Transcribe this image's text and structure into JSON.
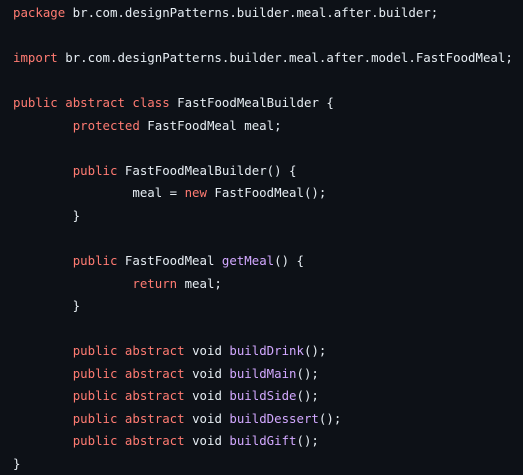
{
  "code": {
    "lines": [
      [
        {
          "t": "package",
          "c": "kw"
        },
        {
          "t": " br.com.designPatterns.builder.meal.after.builder;",
          "c": "tx"
        }
      ],
      [],
      [
        {
          "t": "import",
          "c": "kw"
        },
        {
          "t": " br.com.designPatterns.builder.meal.after.model.FastFoodMeal;",
          "c": "tx"
        }
      ],
      [],
      [
        {
          "t": "public",
          "c": "kw"
        },
        {
          "t": " ",
          "c": "tx"
        },
        {
          "t": "abstract",
          "c": "kw"
        },
        {
          "t": " ",
          "c": "tx"
        },
        {
          "t": "class",
          "c": "kw"
        },
        {
          "t": " FastFoodMealBuilder {",
          "c": "tx"
        }
      ],
      [
        {
          "t": "        ",
          "c": "tx"
        },
        {
          "t": "protected",
          "c": "kw"
        },
        {
          "t": " FastFoodMeal meal;",
          "c": "tx"
        }
      ],
      [],
      [
        {
          "t": "        ",
          "c": "tx"
        },
        {
          "t": "public",
          "c": "kw"
        },
        {
          "t": " FastFoodMealBuilder() {",
          "c": "tx"
        }
      ],
      [
        {
          "t": "                meal = ",
          "c": "tx"
        },
        {
          "t": "new",
          "c": "kw"
        },
        {
          "t": " FastFoodMeal();",
          "c": "tx"
        }
      ],
      [
        {
          "t": "        }",
          "c": "tx"
        }
      ],
      [],
      [
        {
          "t": "        ",
          "c": "tx"
        },
        {
          "t": "public",
          "c": "kw"
        },
        {
          "t": " FastFoodMeal ",
          "c": "tx"
        },
        {
          "t": "getMeal",
          "c": "fn"
        },
        {
          "t": "() {",
          "c": "tx"
        }
      ],
      [
        {
          "t": "                ",
          "c": "tx"
        },
        {
          "t": "return",
          "c": "kw"
        },
        {
          "t": " meal;",
          "c": "tx"
        }
      ],
      [
        {
          "t": "        }",
          "c": "tx"
        }
      ],
      [],
      [
        {
          "t": "        ",
          "c": "tx"
        },
        {
          "t": "public",
          "c": "kw"
        },
        {
          "t": " ",
          "c": "tx"
        },
        {
          "t": "abstract",
          "c": "kw"
        },
        {
          "t": " void ",
          "c": "tx"
        },
        {
          "t": "buildDrink",
          "c": "fn"
        },
        {
          "t": "();",
          "c": "tx"
        }
      ],
      [
        {
          "t": "        ",
          "c": "tx"
        },
        {
          "t": "public",
          "c": "kw"
        },
        {
          "t": " ",
          "c": "tx"
        },
        {
          "t": "abstract",
          "c": "kw"
        },
        {
          "t": " void ",
          "c": "tx"
        },
        {
          "t": "buildMain",
          "c": "fn"
        },
        {
          "t": "();",
          "c": "tx"
        }
      ],
      [
        {
          "t": "        ",
          "c": "tx"
        },
        {
          "t": "public",
          "c": "kw"
        },
        {
          "t": " ",
          "c": "tx"
        },
        {
          "t": "abstract",
          "c": "kw"
        },
        {
          "t": " void ",
          "c": "tx"
        },
        {
          "t": "buildSide",
          "c": "fn"
        },
        {
          "t": "();",
          "c": "tx"
        }
      ],
      [
        {
          "t": "        ",
          "c": "tx"
        },
        {
          "t": "public",
          "c": "kw"
        },
        {
          "t": " ",
          "c": "tx"
        },
        {
          "t": "abstract",
          "c": "kw"
        },
        {
          "t": " void ",
          "c": "tx"
        },
        {
          "t": "buildDessert",
          "c": "fn"
        },
        {
          "t": "();",
          "c": "tx"
        }
      ],
      [
        {
          "t": "        ",
          "c": "tx"
        },
        {
          "t": "public",
          "c": "kw"
        },
        {
          "t": " ",
          "c": "tx"
        },
        {
          "t": "abstract",
          "c": "kw"
        },
        {
          "t": " void ",
          "c": "tx"
        },
        {
          "t": "buildGift",
          "c": "fn"
        },
        {
          "t": "();",
          "c": "tx"
        }
      ],
      [
        {
          "t": "}",
          "c": "tx"
        }
      ]
    ]
  },
  "colors": {
    "background": "#0d1117",
    "keyword": "#ff7b72",
    "function": "#d2a8ff",
    "text": "#e6edf3"
  }
}
